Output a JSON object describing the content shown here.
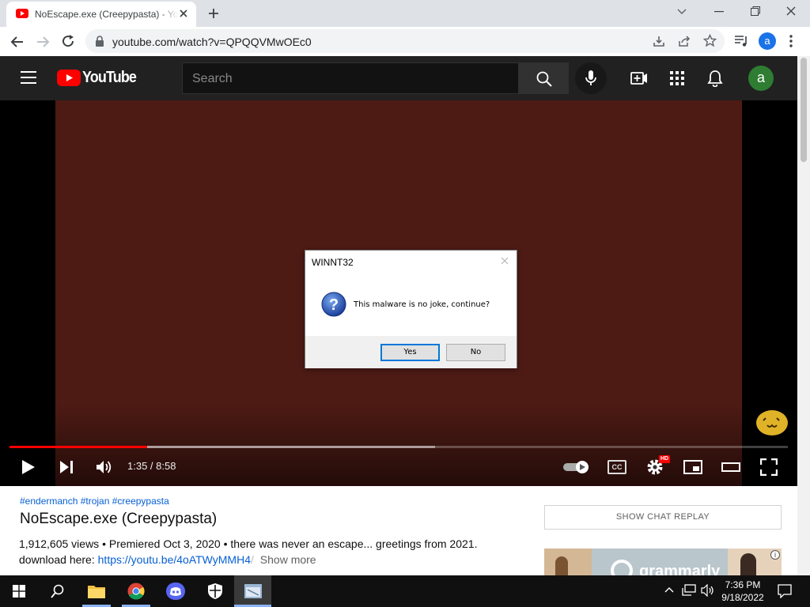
{
  "browser": {
    "tab_title": "NoEscape.exe (Creepypasta) - YouTube",
    "url": "youtube.com/watch?v=QPQQVMwOEc0",
    "profile_initial": "a"
  },
  "youtube": {
    "logo_text": "YouTube",
    "search_placeholder": "Search",
    "avatar_initial": "a"
  },
  "dialog": {
    "title": "WINNT32",
    "message": "This malware is no joke, continue?",
    "yes_label": "Yes",
    "no_label": "No"
  },
  "player": {
    "time": "1:35 / 8:58",
    "hd_badge": "HD",
    "cc_label": "CC",
    "played_fraction": 0.177,
    "buffered_fraction": 0.547
  },
  "video_info": {
    "tags": "#endermanch #trojan #creepypasta",
    "title": "NoEscape.exe (Creepypasta)",
    "meta_line": "1,912,605 views • Premiered Oct 3, 2020 • there was never an escape... greetings from 2021.",
    "download_label": "download here: ",
    "download_link": "https://youtu.be/4oATWyMMH4",
    "show_more": "Show more"
  },
  "sidebar": {
    "chat_replay": "SHOW CHAT REPLAY",
    "ad_brand": "grammarly"
  },
  "taskbar": {
    "time": "7:36 PM",
    "date": "9/18/2022"
  },
  "colors": {
    "video_bg": "#4d1a14",
    "progress_red": "#ff0000",
    "yt_header": "#212121",
    "link_blue": "#065fd4"
  }
}
